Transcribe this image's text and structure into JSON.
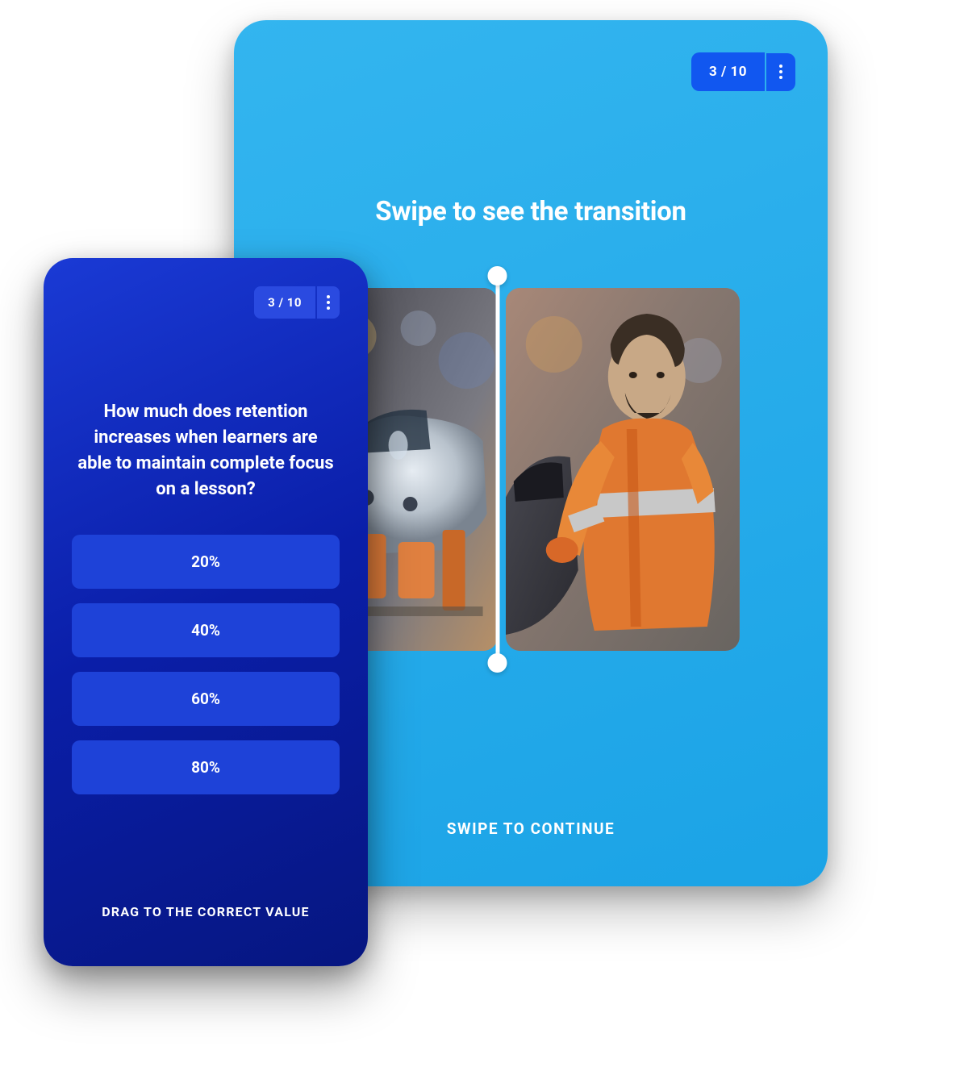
{
  "tablet": {
    "progress": "3 / 10",
    "title": "Swipe to see the transition",
    "cta": "SWIPE TO CONTINUE",
    "image_left_name": "car-assembly-line",
    "image_right_name": "worker-in-orange-on-car"
  },
  "phone": {
    "progress": "3 / 10",
    "question": "How much does retention increases when learners are able to maintain complete focus on a lesson?",
    "options": [
      "20%",
      "40%",
      "60%",
      "80%"
    ],
    "hint": "DRAG TO THE CORRECT VALUE"
  }
}
